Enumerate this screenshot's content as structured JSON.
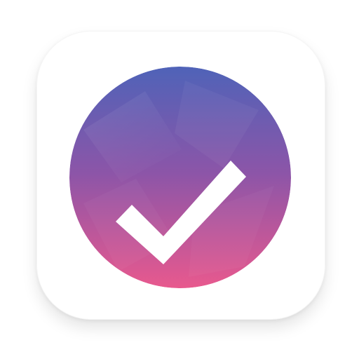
{
  "app_icon": {
    "name": "checkmark-app-icon",
    "colors": {
      "tile_background": "#ffffff",
      "gradient_top": "#4f63b8",
      "gradient_middle": "#8c55a8",
      "gradient_bottom": "#e8598e",
      "check_mark": "#ffffff"
    },
    "icons": [
      "app-tile",
      "gradient-circle",
      "check-mark-icon"
    ]
  }
}
